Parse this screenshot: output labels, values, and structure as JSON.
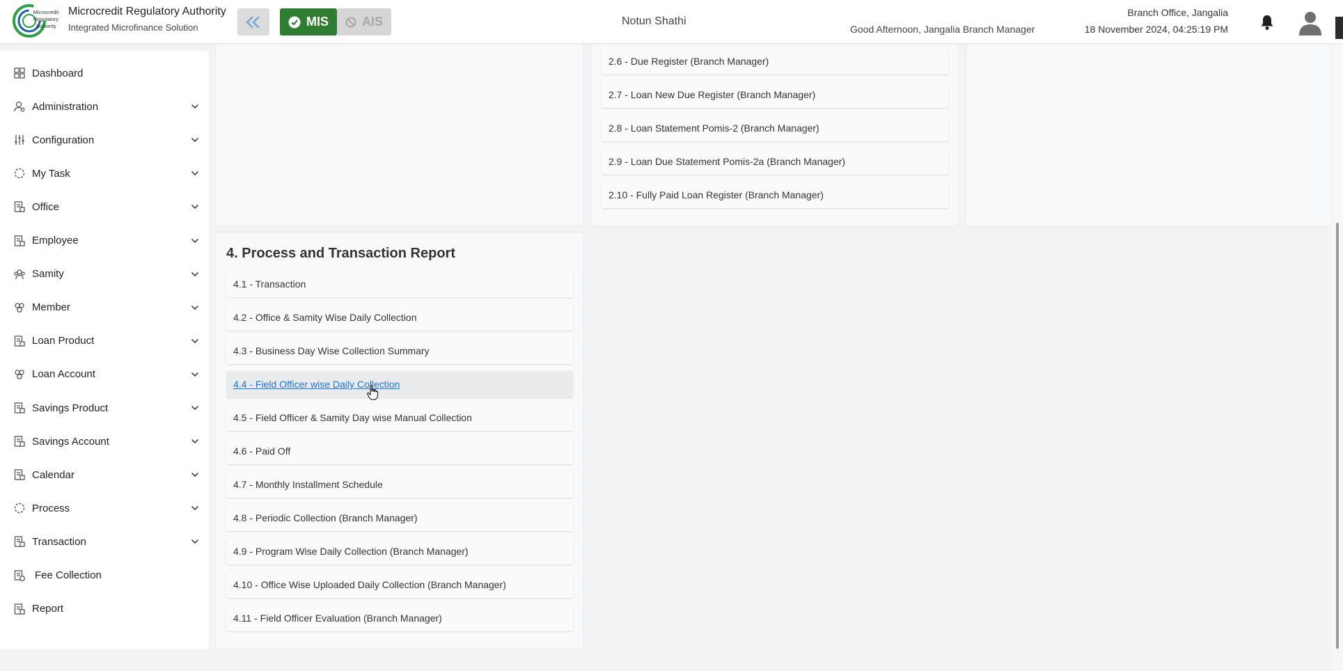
{
  "header": {
    "org_title": "Microcredit Regulatory Authority",
    "org_subtitle": "Integrated Microfinance Solution",
    "logo_text": [
      "Microcredit",
      "Regulatory",
      "Authority"
    ],
    "mis_label": "MIS",
    "ais_label": "AIS",
    "app_name": "Notun Shathi",
    "greeting": "Good Afternoon, Jangalia Branch Manager",
    "branch": "Branch Office, Jangalia",
    "datetime": "18 November 2024, 04:25:19 PM"
  },
  "sidebar": {
    "items": [
      {
        "label": "Dashboard",
        "icon": "grid-icon",
        "expandable": false
      },
      {
        "label": "Administration",
        "icon": "user-gear-icon",
        "expandable": true
      },
      {
        "label": "Configuration",
        "icon": "sliders-icon",
        "expandable": true
      },
      {
        "label": "My Task",
        "icon": "dashed-circle-icon",
        "expandable": true
      },
      {
        "label": "Office",
        "icon": "document-icon",
        "expandable": true
      },
      {
        "label": "Employee",
        "icon": "document-icon",
        "expandable": true
      },
      {
        "label": "Samity",
        "icon": "group-icon",
        "expandable": true
      },
      {
        "label": "Member",
        "icon": "members-icon",
        "expandable": true
      },
      {
        "label": "Loan Product",
        "icon": "document-icon",
        "expandable": true
      },
      {
        "label": "Loan Account",
        "icon": "members-icon",
        "expandable": true
      },
      {
        "label": "Savings Product",
        "icon": "document-icon",
        "expandable": true
      },
      {
        "label": "Savings Account",
        "icon": "document-icon",
        "expandable": true
      },
      {
        "label": "Calendar",
        "icon": "document-icon",
        "expandable": true
      },
      {
        "label": "Process",
        "icon": "dashed-circle-icon",
        "expandable": true
      },
      {
        "label": "Transaction",
        "icon": "document-icon",
        "expandable": true
      },
      {
        "label": "Fee Collection",
        "icon": "fee-icon",
        "expandable": false
      },
      {
        "label": "Report",
        "icon": "document-icon",
        "expandable": false
      }
    ]
  },
  "loan_reports": [
    "2.6 - Due Register (Branch Manager)",
    "2.7 - Loan New Due Register (Branch Manager)",
    "2.8 - Loan Statement Pomis-2 (Branch Manager)",
    "2.9 - Loan Due Statement Pomis-2a (Branch Manager)",
    "2.10 - Fully Paid Loan Register (Branch Manager)"
  ],
  "process_section": {
    "title": "4. Process and Transaction Report",
    "items": [
      "4.1 - Transaction",
      "4.2 - Office & Samity Wise Daily Collection",
      "4.3 - Business Day Wise Collection Summary",
      "4.4 - Field Officer wise Daily Collection",
      "4.5 - Field Officer & Samity Day wise Manual Collection",
      "4.6 - Paid Off",
      "4.7 - Monthly Installment Schedule",
      "4.8 - Periodic Collection (Branch Manager)",
      "4.9 - Program Wise Daily Collection (Branch Manager)",
      "4.10 - Office Wise Uploaded Daily Collection (Branch Manager)",
      "4.11 - Field Officer Evaluation (Branch Manager)"
    ],
    "hovered_index": 3
  },
  "colors": {
    "mis_green": "#2e7d32",
    "link_blue": "#1a73e8",
    "logo_green": "#2e9e44",
    "logo_blue": "#1f5fa8"
  }
}
